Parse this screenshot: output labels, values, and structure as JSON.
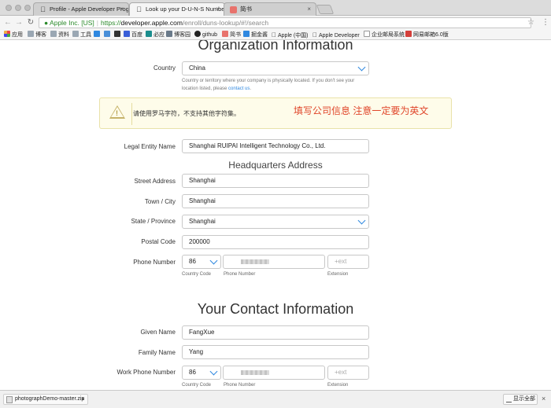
{
  "browser": {
    "tabs": [
      {
        "title": "Profile - Apple Developer Prog"
      },
      {
        "title": "Look up your D-U-N-S Numbe"
      },
      {
        "title": "简书"
      }
    ],
    "address": {
      "ev_label": "Apple Inc. [US]",
      "scheme": "https://",
      "host": "developer.apple.com",
      "path": "/enroll/duns-lookup/#!/search"
    },
    "bookmarks": [
      "应用",
      "博客",
      "资料",
      "工具",
      "",
      "",
      "",
      "百度",
      "必应",
      "博客园",
      "github",
      "简书",
      "掘金酱",
      "Apple (中国)",
      "Apple Developer",
      "企业邮局系统",
      "网易邮箱6.0版"
    ]
  },
  "form": {
    "org_title": "Organization Information",
    "country": {
      "label": "Country",
      "value": "China"
    },
    "country_help": "Country or territory where your company is physically located. If you don't see your location listed, please",
    "contact_link": "contact us",
    "contact_period": ".",
    "warning": {
      "message": "请使用罗马字符，不支持其他字符集。",
      "annotation": "填写公司信息 注意一定要为英文"
    },
    "legal_entity": {
      "label": "Legal Entity Name",
      "value": "Shanghai RUIPAI Intelligent Technology Co., Ltd."
    },
    "hq_title": "Headquarters Address",
    "street": {
      "label": "Street Address",
      "value": "Shanghai"
    },
    "town": {
      "label": "Town / City",
      "value": "Shanghai"
    },
    "state": {
      "label": "State / Province",
      "value": "Shanghai"
    },
    "postal": {
      "label": "Postal Code",
      "value": "200000"
    },
    "phone": {
      "label": "Phone Number",
      "country_code": "86",
      "ext_placeholder": "+ext",
      "sub_country": "Country Code",
      "sub_number": "Phone Number",
      "sub_ext": "Extension"
    },
    "contact_title": "Your Contact Information",
    "given": {
      "label": "Given Name",
      "value": "FangXue"
    },
    "family": {
      "label": "Family Name",
      "value": "Yang"
    },
    "work_phone": {
      "label": "Work Phone Number",
      "country_code": "86",
      "ext_placeholder": "+ext",
      "sub_country": "Country Code",
      "sub_number": "Phone Number",
      "sub_ext": "Extension"
    }
  },
  "downloads": {
    "file": "photographDemo-master.zip",
    "show_all": "显示全部"
  }
}
